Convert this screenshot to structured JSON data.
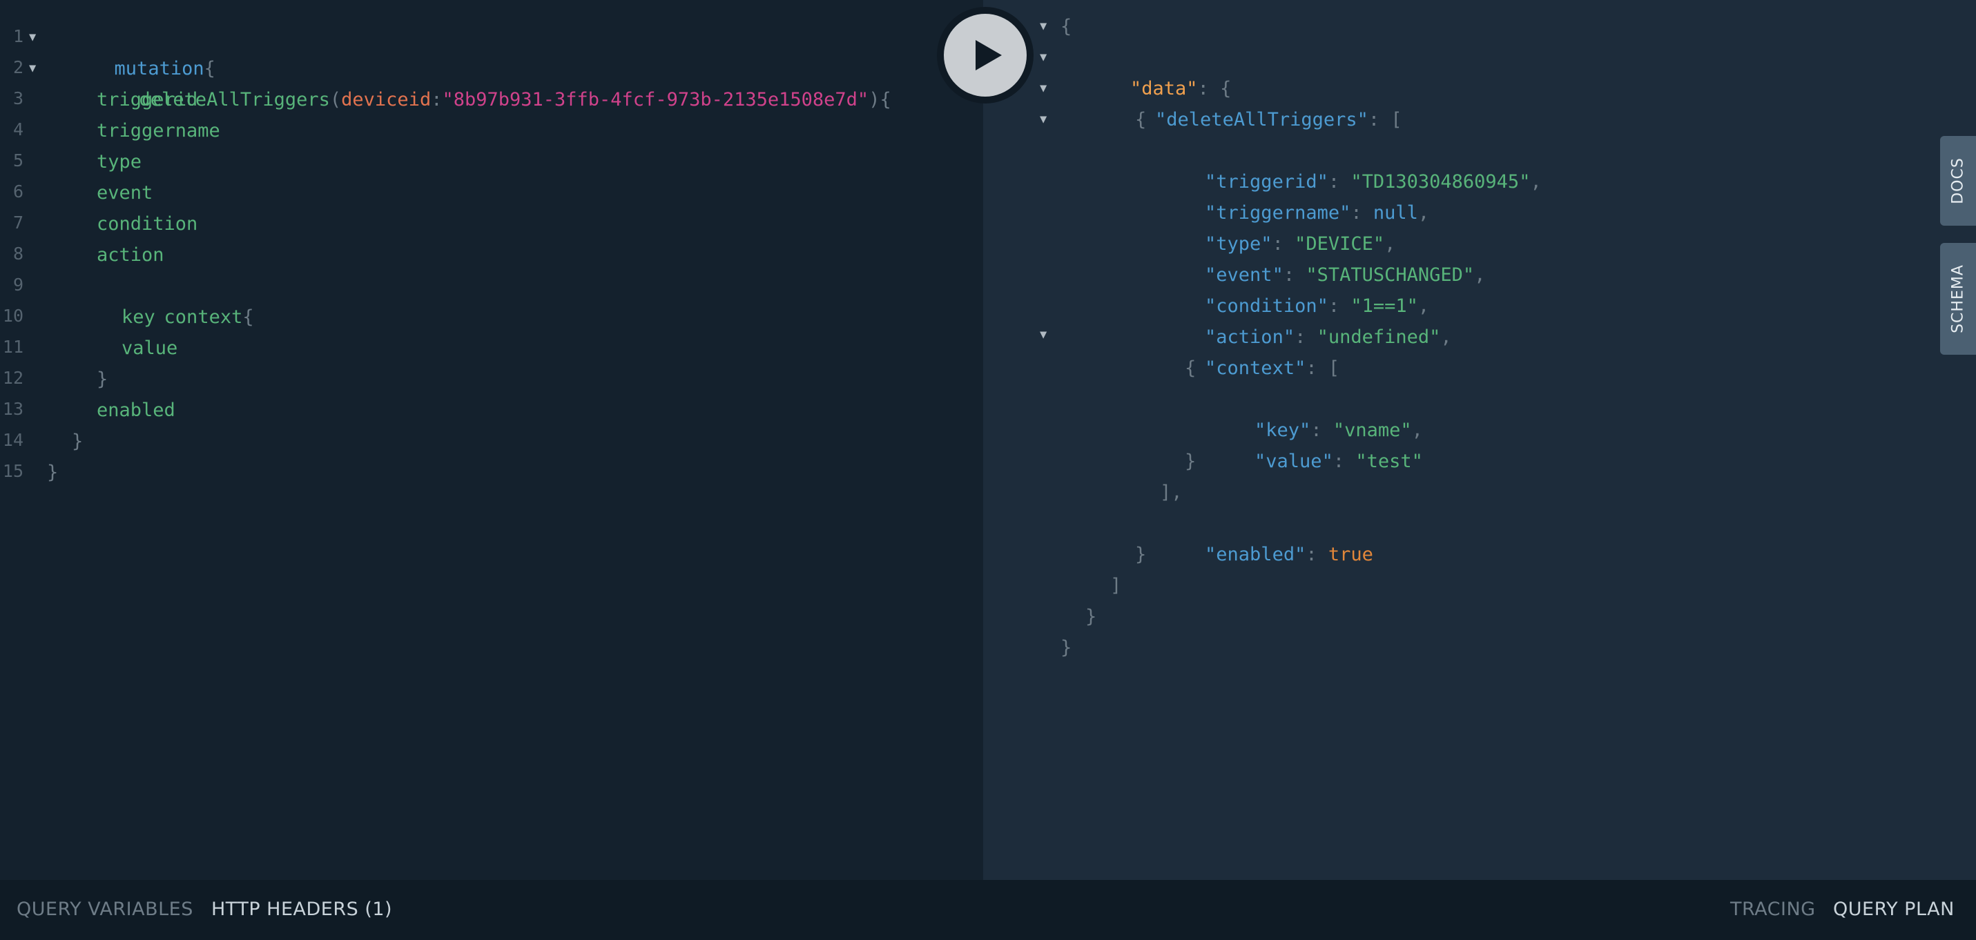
{
  "query": {
    "line_numbers": [
      "1",
      "2",
      "3",
      "4",
      "5",
      "6",
      "7",
      "8",
      "9",
      "10",
      "11",
      "12",
      "13",
      "14",
      "15"
    ],
    "keyword": "mutation",
    "open_brace": "{",
    "field_name": "deleteAllTriggers",
    "open_paren": "(",
    "arg_name": "deviceid",
    "colon": ":",
    "arg_value": "\"8b97b931-3ffb-4fcf-973b-2135e1508e7d\"",
    "close_paren_brace": "){",
    "fields": [
      "triggerid",
      "triggername",
      "type",
      "event",
      "condition",
      "action"
    ],
    "context_field": "context",
    "context_brace": "{",
    "context_fields": [
      "key",
      "value"
    ],
    "context_close": "}",
    "enabled_field": "enabled",
    "inner_close": "}",
    "outer_close": "}"
  },
  "response": {
    "open_brace": "{",
    "data_key": "\"data\"",
    "data_open": "{",
    "delete_key": "\"deleteAllTriggers\"",
    "delete_open": "[",
    "item_open": "{",
    "triggerid_key": "\"triggerid\"",
    "triggerid_value": "\"TD130304860945\"",
    "triggername_key": "\"triggername\"",
    "triggername_value": "null",
    "type_key": "\"type\"",
    "type_value": "\"DEVICE\"",
    "event_key": "\"event\"",
    "event_value": "\"STATUSCHANGED\"",
    "condition_key": "\"condition\"",
    "condition_value": "\"1==1\"",
    "action_key": "\"action\"",
    "action_value": "\"undefined\"",
    "context_key": "\"context\"",
    "context_open": "[",
    "ctx_item_open": "{",
    "key_key": "\"key\"",
    "key_value": "\"vname\"",
    "value_key": "\"value\"",
    "value_value": "\"test\"",
    "ctx_item_close": "}",
    "context_close": "],",
    "enabled_key": "\"enabled\"",
    "enabled_value": "true",
    "item_close": "}",
    "delete_close": "]",
    "data_close": "}",
    "close_brace": "}",
    "colon_sep": ": ",
    "comma": ","
  },
  "side_tabs": {
    "docs": "DOCS",
    "schema": "SCHEMA"
  },
  "bottom_bar": {
    "query_variables": "QUERY VARIABLES",
    "http_headers": "HTTP HEADERS (1)",
    "tracing": "TRACING",
    "query_plan": "QUERY PLAN"
  },
  "colors": {
    "editor_bg": "#14212d",
    "result_bg": "#1d2c3b",
    "keyword": "#4d9bd1",
    "field": "#58b47a",
    "argument": "#e2734f",
    "string_arg": "#d0428b",
    "json_data_key": "#f0a04e",
    "bool": "#e2873a"
  }
}
